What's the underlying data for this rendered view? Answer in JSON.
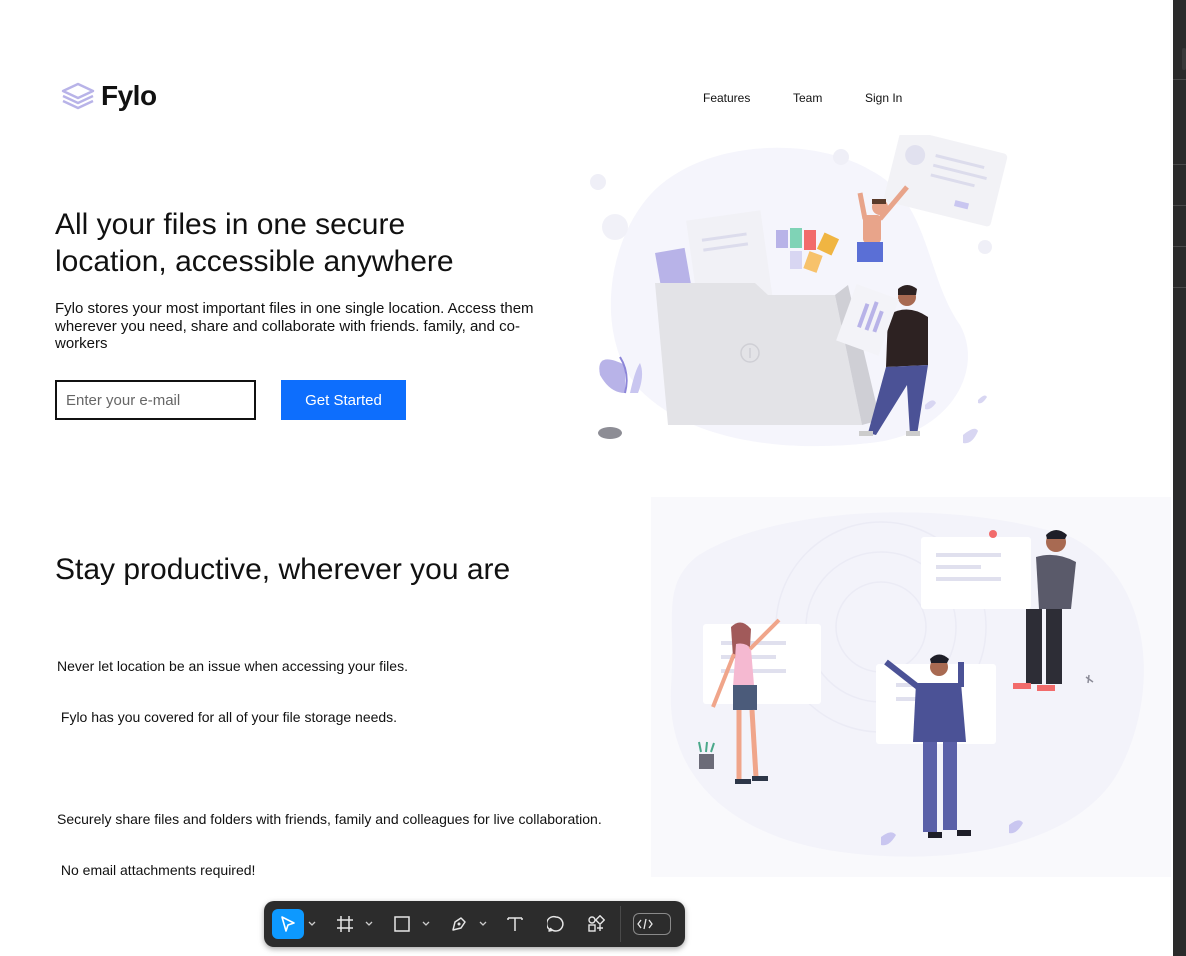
{
  "header": {
    "logo_text": "Fylo",
    "nav": [
      {
        "label": "Features"
      },
      {
        "label": "Team"
      },
      {
        "label": "Sign In"
      }
    ]
  },
  "hero": {
    "title_line1": "All your files in one secure",
    "title_line2": "location, accessible anywhere",
    "description": "Fylo stores your most important files in one single location. Access them wherever you need, share and collaborate with friends. family, and co-workers",
    "email_placeholder": "Enter your e-mail",
    "email_value": "",
    "cta_label": "Get Started"
  },
  "productive": {
    "title": "Stay productive, wherever you are",
    "line1": "Never let location be an issue when accessing your files.",
    "line2": " Fylo has you covered for all of your file storage needs.",
    "line3": "Securely share files and folders with friends, family and colleagues for live collaboration.",
    "line4": " No email attachments required!"
  },
  "toolbar": {
    "tools": [
      {
        "icon": "cursor-icon",
        "active": true
      },
      {
        "icon": "frame-icon"
      },
      {
        "icon": "rectangle-icon"
      },
      {
        "icon": "pen-icon"
      },
      {
        "icon": "text-icon"
      },
      {
        "icon": "comment-icon"
      },
      {
        "icon": "components-icon"
      }
    ],
    "mode_toggle": "code-toggle-icon"
  },
  "colors": {
    "accent": "#0d6efd",
    "toolbar_bg": "#2c2c2c",
    "tool_active": "#0d99ff",
    "illustration_tint": "#f5f5fc",
    "logo_lilac": "#b8b3e8"
  }
}
